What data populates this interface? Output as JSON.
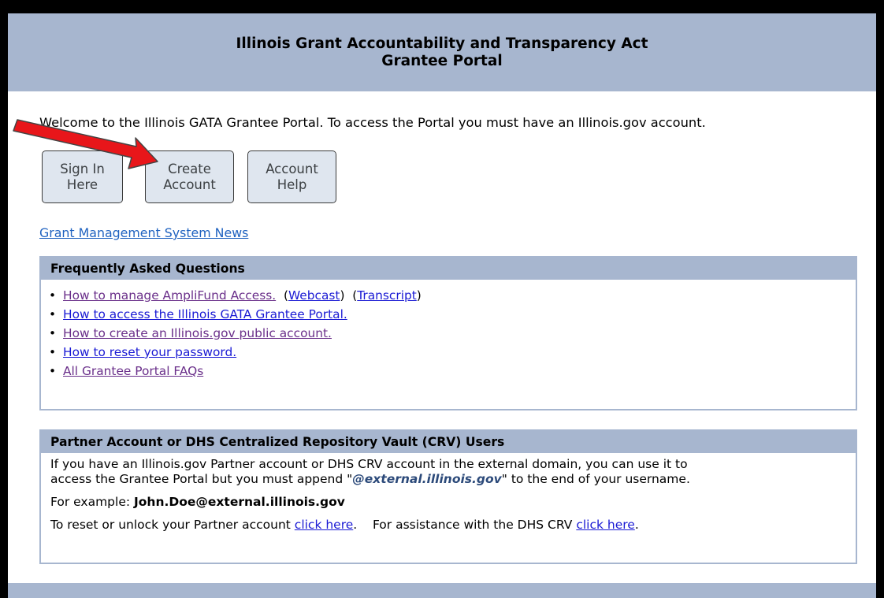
{
  "header": {
    "title_line1": "Illinois Grant Accountability and Transparency Act",
    "title_line2": "Grantee Portal"
  },
  "welcome_text": "Welcome to the Illinois GATA Grantee Portal. To access the Portal you must have an Illinois.gov account.",
  "buttons": {
    "sign_in": [
      "Sign In",
      "Here"
    ],
    "create_account": [
      "Create",
      "Account"
    ],
    "account_help": [
      "Account",
      "Help"
    ]
  },
  "news_link": "Grant Management System News",
  "faq": {
    "title": "Frequently Asked Questions",
    "item1": "How to manage AmpliFund Access.",
    "webcast": "Webcast",
    "transcript": "Transcript",
    "item2": "How to access the Illinois GATA Grantee Portal.",
    "item3": "How to create an Illinois.gov public account.",
    "item4": "How to reset your password.",
    "item5": "All Grantee Portal FAQs"
  },
  "partner": {
    "title": "Partner Account or DHS Centralized Repository Vault (CRV) Users",
    "para1_line1": "If you have an Illinois.gov Partner account or DHS CRV account in the external domain, you can use it to",
    "para1_line2_a": "access the Grantee Portal but you must append \"",
    "para1_domain": "@external.illinois.gov",
    "para1_line2_b": "\" to the end of your username.",
    "example_label": "For example: ",
    "example_value": "John.Doe@external.illinois.gov",
    "reset_text": "To reset or unlock your Partner account ",
    "reset_link": "click here",
    "assist_text": "For assistance with the DHS CRV ",
    "assist_link": "click here"
  },
  "colors": {
    "header_bg": "#a7b6cf",
    "button_bg": "#dfe6ef",
    "link": "#1a1ad4",
    "visited_link": "#6a2f8a",
    "arrow": "#e8161a"
  },
  "annotation": "red-arrow-pointing-to-create-account"
}
